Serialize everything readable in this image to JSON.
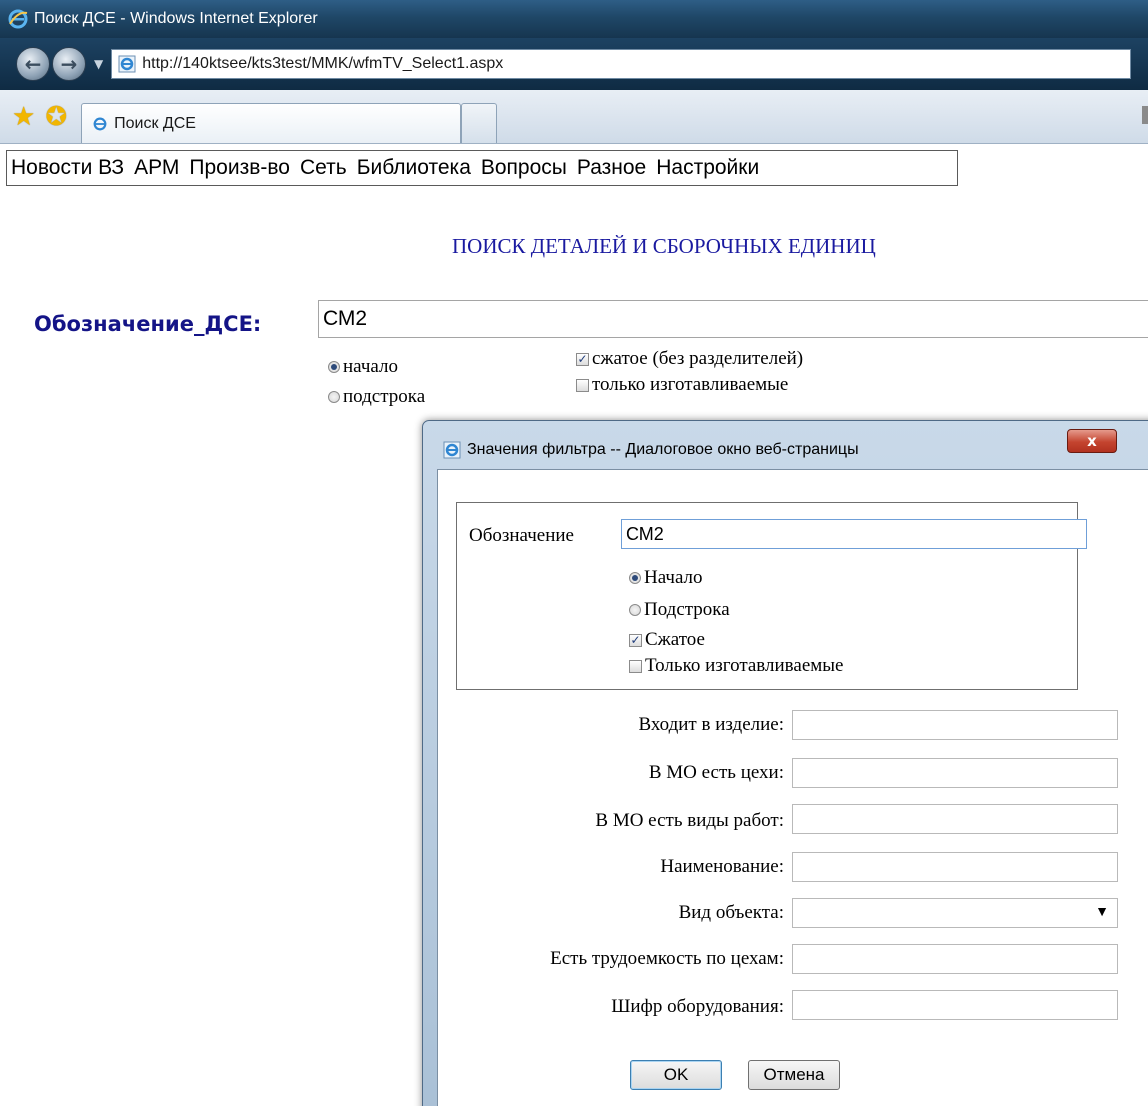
{
  "window": {
    "title": "Поиск ДСЕ - Windows Internet Explorer",
    "address": "http://140ktsee/kts3test/MMK/wfmTV_Select1.aspx",
    "tab_title": "Поиск ДСЕ"
  },
  "menu": [
    "Новости ВЗ",
    "АРМ",
    "Произв-во",
    "Сеть",
    "Библиотека",
    "Вопросы",
    "Разное",
    "Настройки"
  ],
  "page": {
    "title": "ПОИСК ДЕТАЛЕЙ И СБОРОЧНЫХ ЕДИНИЦ",
    "dse_label": "Обозначение_ДСЕ:",
    "dse_value": "СМ2",
    "radio_start": {
      "label": "начало",
      "checked": true
    },
    "radio_substring": {
      "label": "подстрока",
      "checked": false
    },
    "check_compressed": {
      "label": "сжатое (без разделителей)",
      "checked": true
    },
    "check_made_only": {
      "label": "только изготавливаемые",
      "checked": false
    }
  },
  "dialog": {
    "title": "Значения фильтра -- Диалоговое окно веб-страницы",
    "close_glyph": "x",
    "designation_label": "Обозначение",
    "designation_value": "СМ2",
    "radio_start": {
      "label": "Начало",
      "checked": true
    },
    "radio_substring": {
      "label": "Подстрока",
      "checked": false
    },
    "check_compressed": {
      "label": "Сжатое",
      "checked": true
    },
    "check_made_only": {
      "label": "Только изготавливаемые",
      "checked": false
    },
    "fields": {
      "part_of": {
        "label": "Входит в изделие:",
        "value": ""
      },
      "workshops": {
        "label": "В МО есть цехи:",
        "value": ""
      },
      "work_types": {
        "label": "В МО есть виды работ:",
        "value": ""
      },
      "name": {
        "label": "Наименование:",
        "value": ""
      },
      "object_type": {
        "label": "Вид объекта:",
        "value": ""
      },
      "labor": {
        "label": "Есть трудоемкость по цехам:",
        "value": ""
      },
      "equipment": {
        "label": "Шифр оборудования:",
        "value": ""
      }
    },
    "ok_label": "OK",
    "cancel_label": "Отмена"
  },
  "icons": {
    "ie": "ie-logo-icon",
    "back": "back-arrow-icon",
    "forward": "forward-arrow-icon",
    "favorites": "favorites-star-icon",
    "add_favorites": "add-favorites-icon",
    "dropdown": "chevron-down-icon"
  },
  "colors": {
    "title_blue": "#1a1aa0",
    "label_blue": "#141487",
    "titlebar": "#1f4767",
    "close_red": "#c4442f"
  }
}
